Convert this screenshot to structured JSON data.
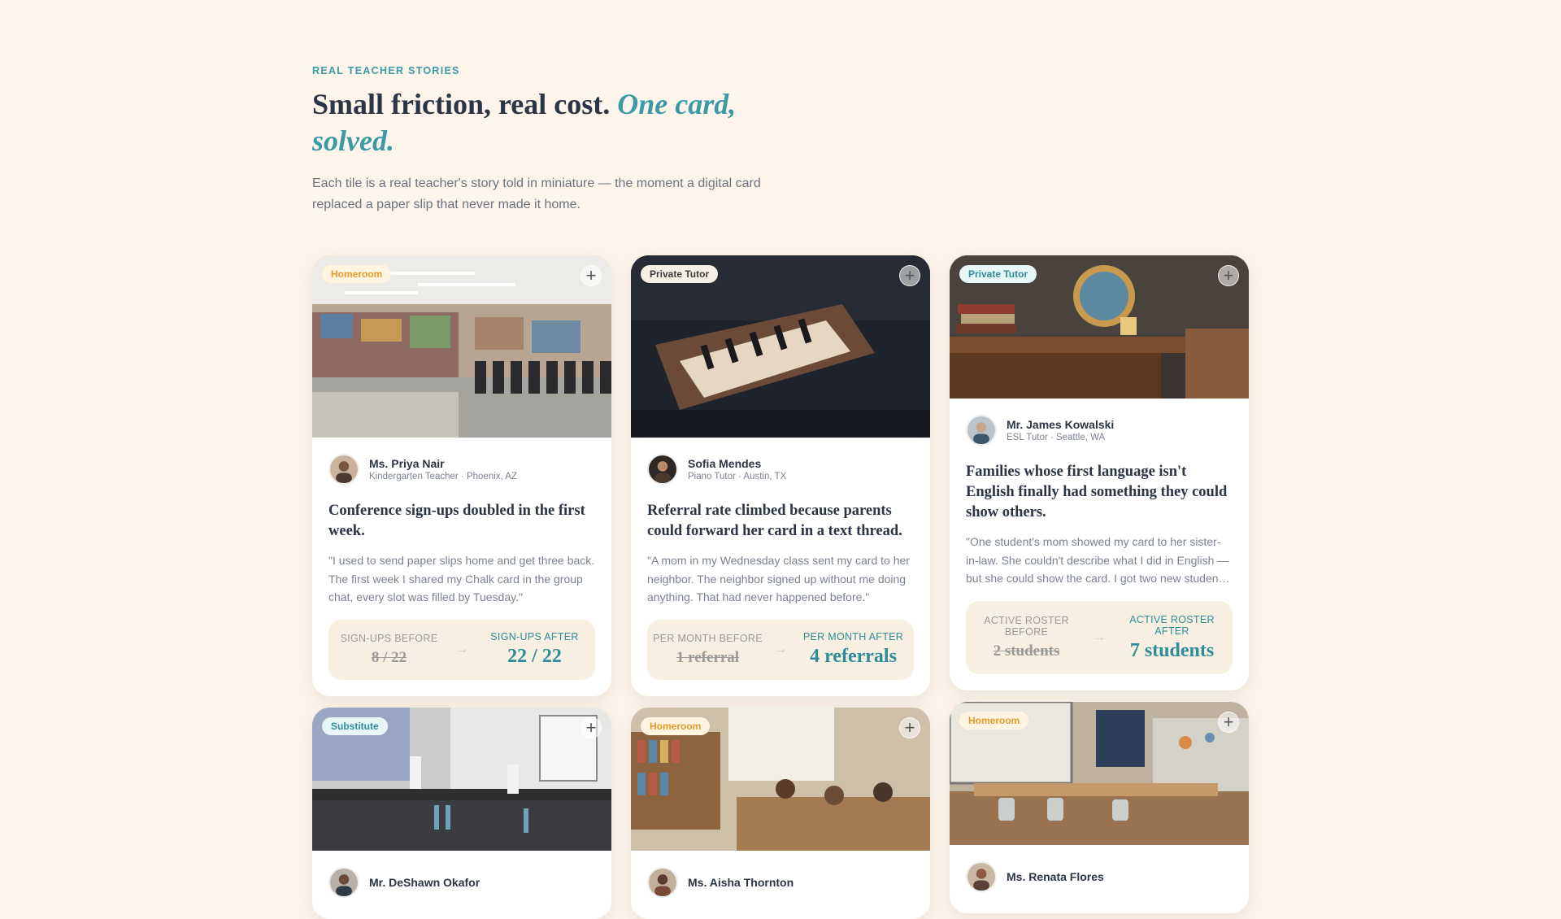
{
  "section": {
    "eyebrow": "REAL TEACHER STORIES",
    "headline_plain": "Small friction, real cost.",
    "headline_accent": "One card, solved.",
    "intro": "Each tile is a real teacher's story told in miniature — the moment a digital card replaced a paper slip that never made it home."
  },
  "colors": {
    "accent": "#3a9aa6",
    "background": "#fdf5ec",
    "homeroom_tag": "#e49b2a"
  },
  "cards": [
    {
      "tag": "Homeroom",
      "add_icon": "plus-icon",
      "name": "Ms. Priya Nair",
      "role": "Kindergarten Teacher · Phoenix, AZ",
      "title": "Conference sign-ups doubled in the first week.",
      "quote": "\"I used to send paper slips home and get three back. The first week I shared my Chalk card in the group chat, every slot was filled by Tuesday.\"",
      "before_label": "SIGN-UPS BEFORE",
      "before_value": "8 / 22",
      "after_label": "SIGN-UPS AFTER",
      "after_value": "22 / 22"
    },
    {
      "tag": "Private Tutor",
      "add_icon": "plus-icon",
      "name": "Sofia Mendes",
      "role": "Piano Tutor · Austin, TX",
      "title": "Referral rate climbed because parents could forward her card in a text thread.",
      "quote": "\"A mom in my Wednesday class sent my card to her neighbor. The neighbor signed up without me doing anything. That had never happened before.\"",
      "before_label": "PER MONTH BEFORE",
      "before_value": "1 referral",
      "after_label": "PER MONTH AFTER",
      "after_value": "4 referrals"
    },
    {
      "tag": "Private Tutor",
      "add_icon": "plus-icon",
      "name": "Mr. James Kowalski",
      "role": "ESL Tutor · Seattle, WA",
      "title": "Families whose first language isn't English finally had something they could show others.",
      "quote": "\"One student's mom showed my card to her sister-in-law. She couldn't describe what I did in English — but she could show the card. I got two new studen…",
      "before_label": "ACTIVE ROSTER BEFORE",
      "before_value": "2 students",
      "after_label": "ACTIVE ROSTER AFTER",
      "after_value": "7 students"
    },
    {
      "tag": "Substitute",
      "add_icon": "plus-icon",
      "name": "Mr. DeShawn Okafor"
    },
    {
      "tag": "Homeroom",
      "add_icon": "plus-icon",
      "name": "Ms. Aisha Thornton"
    },
    {
      "tag": "Homeroom",
      "add_icon": "plus-icon",
      "name": "Ms. Renata Flores"
    }
  ]
}
